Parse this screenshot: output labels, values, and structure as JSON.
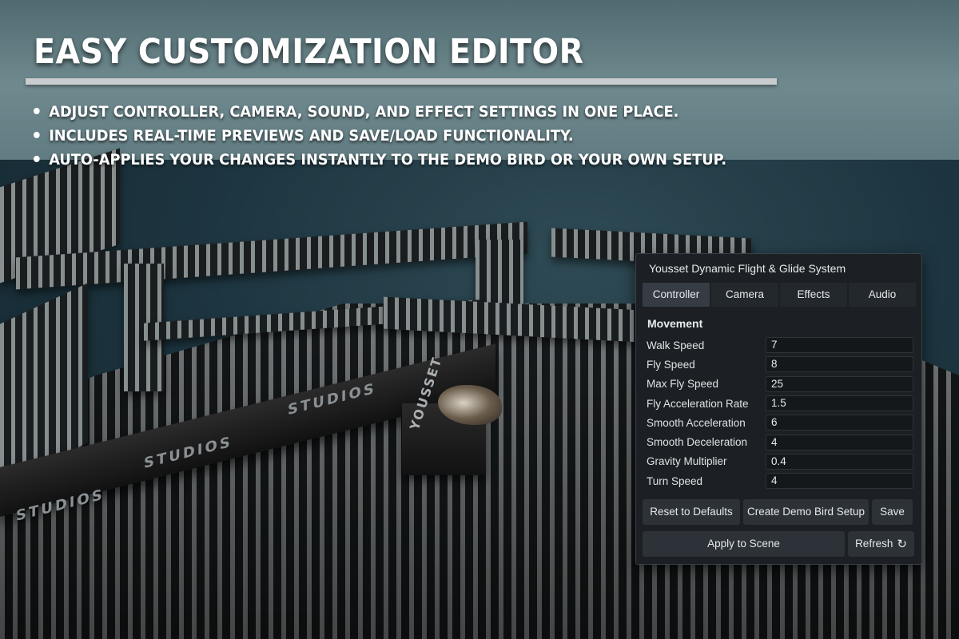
{
  "hero": {
    "title": "EASY CUSTOMIZATION EDITOR",
    "bullets": [
      "ADJUST CONTROLLER, CAMERA, SOUND, AND EFFECT SETTINGS IN ONE PLACE.",
      "INCLUDES REAL-TIME PREVIEWS AND SAVE/LOAD FUNCTIONALITY.",
      "AUTO-APPLIES YOUR CHANGES INSTANTLY TO THE DEMO BIRD OR YOUR OWN SETUP."
    ]
  },
  "scene": {
    "plank_text": [
      "STUDIOS",
      "STUDIOS",
      "STUDIOS"
    ],
    "block_text": "YOUSSET"
  },
  "panel": {
    "title": "Yousset Dynamic Flight & Glide System",
    "tabs": [
      "Controller",
      "Camera",
      "Effects",
      "Audio"
    ],
    "active_tab": "Controller",
    "section": "Movement",
    "fields": [
      {
        "label": "Walk Speed",
        "value": "7"
      },
      {
        "label": "Fly Speed",
        "value": "8"
      },
      {
        "label": "Max Fly Speed",
        "value": "25"
      },
      {
        "label": "Fly Acceleration Rate",
        "value": "1.5"
      },
      {
        "label": "Smooth Acceleration",
        "value": "6"
      },
      {
        "label": "Smooth Deceleration",
        "value": "4"
      },
      {
        "label": "Gravity Multiplier",
        "value": "0.4"
      },
      {
        "label": "Turn Speed",
        "value": "4"
      }
    ],
    "buttons": {
      "reset": "Reset to Defaults",
      "create_demo": "Create Demo Bird Setup",
      "save": "Save",
      "apply": "Apply to Scene",
      "refresh": "Refresh"
    },
    "icons": {
      "refresh": "refresh-icon"
    }
  }
}
